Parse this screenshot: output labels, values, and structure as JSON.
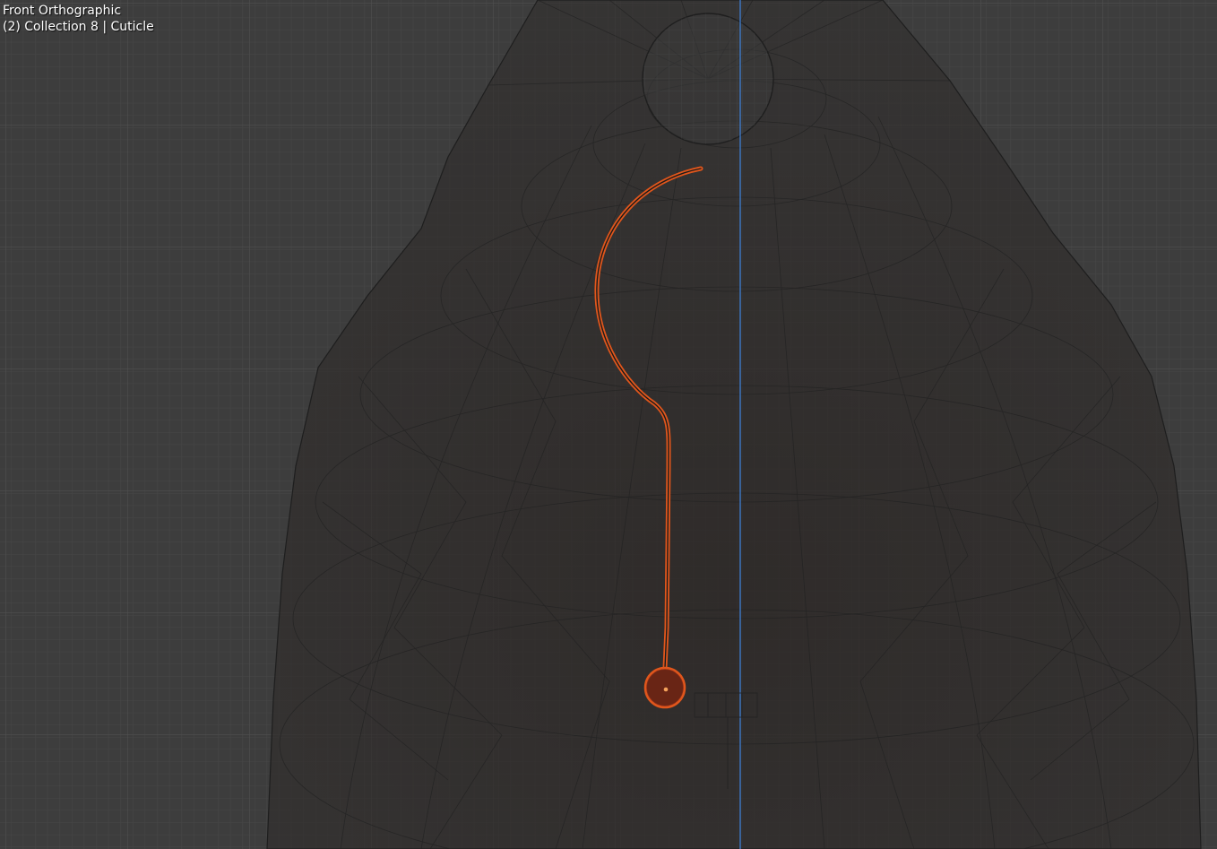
{
  "viewport": {
    "view_name": "Front Orthographic",
    "collection_info": "(2) Collection 8 | Cuticle",
    "background_color": "#3d3d3d",
    "grid_color": "#4a4a4a",
    "z_axis_color": "#3f7fd4",
    "selection_color": "#e0561c",
    "object_origin_color": "#f5a35c",
    "mesh_fill_color": "#2e2a28",
    "wire_color": "#1c1c1c"
  }
}
